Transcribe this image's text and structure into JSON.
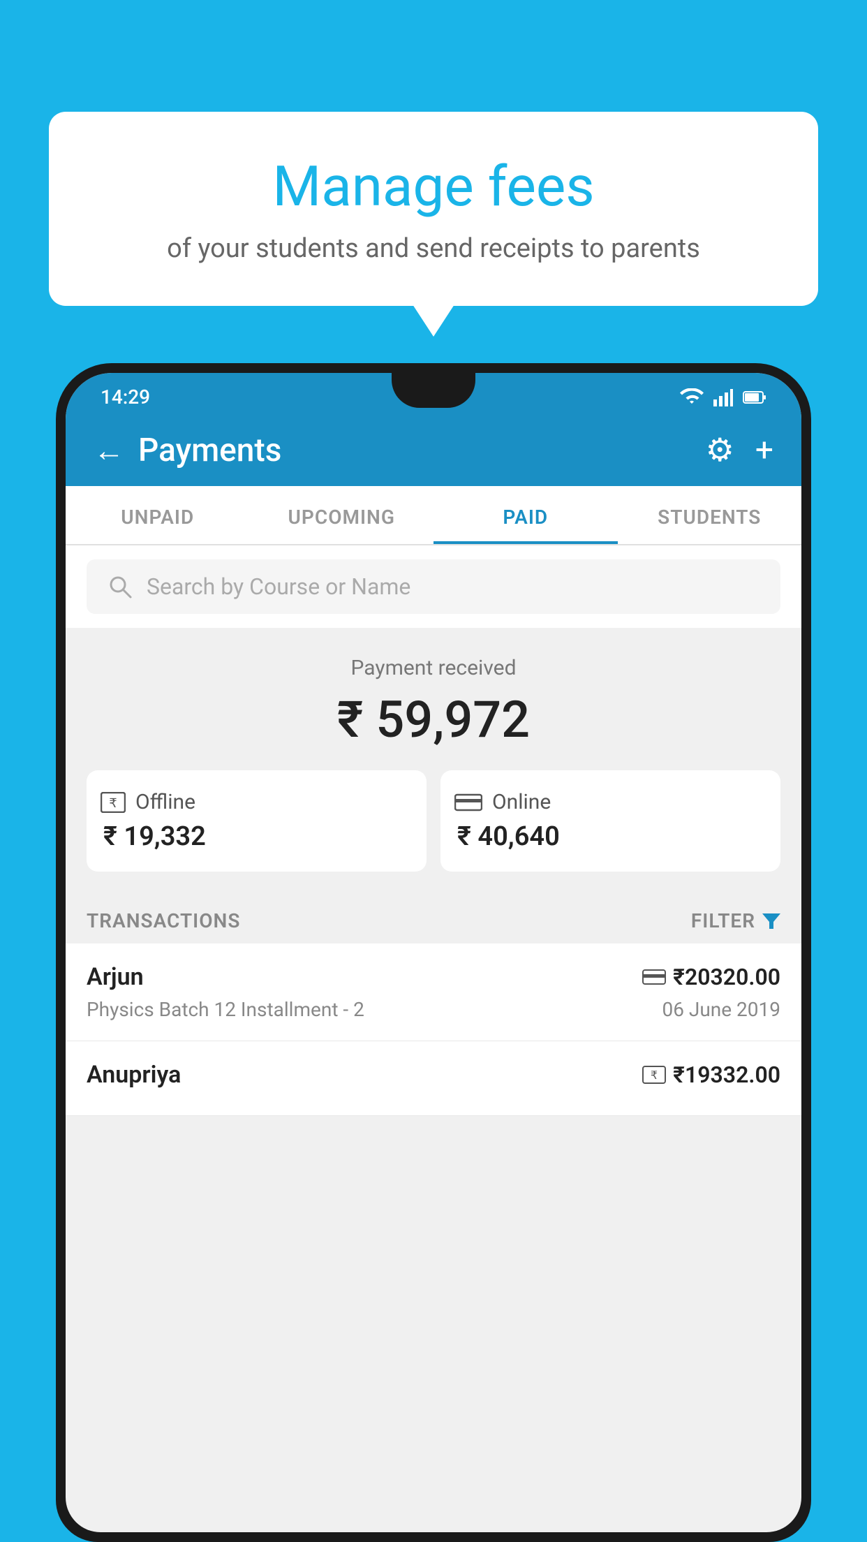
{
  "page": {
    "background_color": "#1ab4e8"
  },
  "speech_bubble": {
    "title": "Manage fees",
    "subtitle": "of your students and send receipts to parents"
  },
  "status_bar": {
    "time": "14:29",
    "icons": [
      "wifi",
      "signal",
      "battery"
    ]
  },
  "top_bar": {
    "title": "Payments",
    "back_label": "←",
    "gear_label": "⚙",
    "plus_label": "+"
  },
  "tabs": [
    {
      "label": "UNPAID",
      "active": false
    },
    {
      "label": "UPCOMING",
      "active": false
    },
    {
      "label": "PAID",
      "active": true
    },
    {
      "label": "STUDENTS",
      "active": false
    }
  ],
  "search": {
    "placeholder": "Search by Course or Name"
  },
  "payment_summary": {
    "received_label": "Payment received",
    "total_amount": "₹ 59,972",
    "offline": {
      "label": "Offline",
      "amount": "₹ 19,332"
    },
    "online": {
      "label": "Online",
      "amount": "₹ 40,640"
    }
  },
  "transactions": {
    "header_label": "TRANSACTIONS",
    "filter_label": "FILTER",
    "items": [
      {
        "name": "Arjun",
        "course": "Physics Batch 12 Installment - 2",
        "amount": "₹20320.00",
        "date": "06 June 2019",
        "type": "online"
      },
      {
        "name": "Anupriya",
        "course": "",
        "amount": "₹19332.00",
        "date": "",
        "type": "offline"
      }
    ]
  }
}
